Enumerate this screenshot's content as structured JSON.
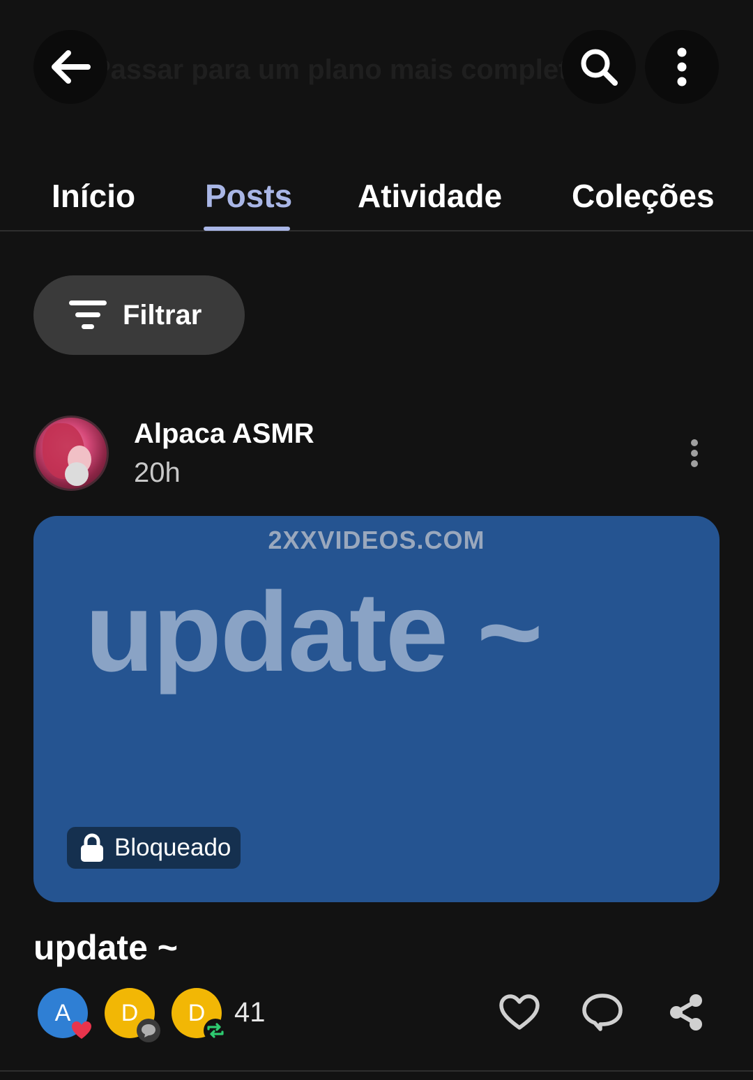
{
  "header": {
    "faded_banner": "Passar para um plano mais completo"
  },
  "tabs": [
    {
      "label": "Início",
      "active": false
    },
    {
      "label": "Posts",
      "active": true
    },
    {
      "label": "Atividade",
      "active": false
    },
    {
      "label": "Coleções",
      "active": false
    }
  ],
  "filter": {
    "label": "Filtrar"
  },
  "post": {
    "author": "Alpaca ASMR",
    "time": "20h",
    "card": {
      "watermark": "2XXVIDEOS.COM",
      "title": "update ~",
      "locked_label": "Bloqueado"
    },
    "title": "update ~",
    "reactions": {
      "avatars": [
        {
          "initial": "A",
          "badge": "heart-icon"
        },
        {
          "initial": "D",
          "badge": "comment-icon"
        },
        {
          "initial": "D",
          "badge": "repost-icon"
        }
      ],
      "count": "41"
    }
  },
  "colors": {
    "background": "#121212",
    "accent_tab": "#a9b6e6",
    "card": "#255491",
    "filter_button": "#3a3a3a"
  }
}
